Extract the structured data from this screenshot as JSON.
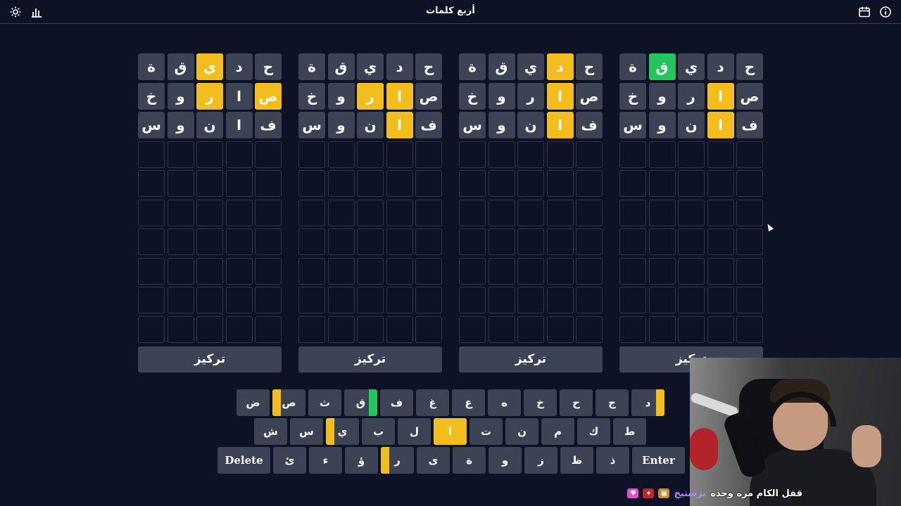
{
  "header": {
    "title": "أربع كلمات",
    "icons": [
      "settings-icon",
      "stats-icon",
      "calendar-icon",
      "info-icon"
    ]
  },
  "colors": {
    "background": "#0d1224",
    "filled_tile": "#3b4354",
    "present_yellow": "#f2bd1d",
    "correct_green": "#22c55e"
  },
  "boards": [
    {
      "focus_label": "تركيز",
      "rows": [
        [
          {
            "l": "ة",
            "s": "f"
          },
          {
            "l": "ق",
            "s": "f"
          },
          {
            "l": "ي",
            "s": "y"
          },
          {
            "l": "د",
            "s": "f"
          },
          {
            "l": "ح",
            "s": "f"
          }
        ],
        [
          {
            "l": "خ",
            "s": "f"
          },
          {
            "l": "و",
            "s": "f"
          },
          {
            "l": "ر",
            "s": "y"
          },
          {
            "l": "ا",
            "s": "f"
          },
          {
            "l": "ص",
            "s": "y"
          }
        ],
        [
          {
            "l": "س",
            "s": "f"
          },
          {
            "l": "و",
            "s": "f"
          },
          {
            "l": "ن",
            "s": "f"
          },
          {
            "l": "ا",
            "s": "f"
          },
          {
            "l": "ف",
            "s": "f"
          }
        ]
      ]
    },
    {
      "focus_label": "تركيز",
      "rows": [
        [
          {
            "l": "ة",
            "s": "f"
          },
          {
            "l": "ق",
            "s": "f"
          },
          {
            "l": "ي",
            "s": "f"
          },
          {
            "l": "د",
            "s": "f"
          },
          {
            "l": "ح",
            "s": "f"
          }
        ],
        [
          {
            "l": "خ",
            "s": "f"
          },
          {
            "l": "و",
            "s": "f"
          },
          {
            "l": "ر",
            "s": "y"
          },
          {
            "l": "ا",
            "s": "y"
          },
          {
            "l": "ص",
            "s": "f"
          }
        ],
        [
          {
            "l": "س",
            "s": "f"
          },
          {
            "l": "و",
            "s": "f"
          },
          {
            "l": "ن",
            "s": "f"
          },
          {
            "l": "ا",
            "s": "y"
          },
          {
            "l": "ف",
            "s": "f"
          }
        ]
      ]
    },
    {
      "focus_label": "تركيز",
      "rows": [
        [
          {
            "l": "ة",
            "s": "f"
          },
          {
            "l": "ق",
            "s": "f"
          },
          {
            "l": "ي",
            "s": "f"
          },
          {
            "l": "د",
            "s": "y"
          },
          {
            "l": "ح",
            "s": "f"
          }
        ],
        [
          {
            "l": "خ",
            "s": "f"
          },
          {
            "l": "و",
            "s": "f"
          },
          {
            "l": "ر",
            "s": "f"
          },
          {
            "l": "ا",
            "s": "y"
          },
          {
            "l": "ص",
            "s": "f"
          }
        ],
        [
          {
            "l": "س",
            "s": "f"
          },
          {
            "l": "و",
            "s": "f"
          },
          {
            "l": "ن",
            "s": "f"
          },
          {
            "l": "ا",
            "s": "y"
          },
          {
            "l": "ف",
            "s": "f"
          }
        ]
      ]
    },
    {
      "focus_label": "تركيز",
      "rows": [
        [
          {
            "l": "ة",
            "s": "f"
          },
          {
            "l": "ق",
            "s": "g"
          },
          {
            "l": "ي",
            "s": "f"
          },
          {
            "l": "د",
            "s": "f"
          },
          {
            "l": "ح",
            "s": "f"
          }
        ],
        [
          {
            "l": "خ",
            "s": "f"
          },
          {
            "l": "و",
            "s": "f"
          },
          {
            "l": "ر",
            "s": "f"
          },
          {
            "l": "ا",
            "s": "y"
          },
          {
            "l": "ص",
            "s": "f"
          }
        ],
        [
          {
            "l": "س",
            "s": "f"
          },
          {
            "l": "و",
            "s": "f"
          },
          {
            "l": "ن",
            "s": "f"
          },
          {
            "l": "ا",
            "s": "y"
          },
          {
            "l": "ف",
            "s": "f"
          }
        ]
      ]
    }
  ],
  "keyboard": {
    "rows": [
      [
        {
          "k": "ض"
        },
        {
          "k": "ص",
          "mark": "y-left"
        },
        {
          "k": "ث"
        },
        {
          "k": "ق",
          "mark": "g-right"
        },
        {
          "k": "ف"
        },
        {
          "k": "غ"
        },
        {
          "k": "ع"
        },
        {
          "k": "ه"
        },
        {
          "k": "خ"
        },
        {
          "k": "ح"
        },
        {
          "k": "ج"
        },
        {
          "k": "د",
          "mark": "y-right"
        }
      ],
      [
        {
          "k": "ش"
        },
        {
          "k": "س"
        },
        {
          "k": "ي",
          "mark": "y-left"
        },
        {
          "k": "ب"
        },
        {
          "k": "ل"
        },
        {
          "k": "ا",
          "mark": "full-y"
        },
        {
          "k": "ت"
        },
        {
          "k": "ن"
        },
        {
          "k": "م"
        },
        {
          "k": "ك"
        },
        {
          "k": "ط"
        }
      ],
      [
        {
          "k": "Delete",
          "wide": true
        },
        {
          "k": "ئ"
        },
        {
          "k": "ء"
        },
        {
          "k": "ؤ"
        },
        {
          "k": "ر",
          "mark": "y-left"
        },
        {
          "k": "ى"
        },
        {
          "k": "ة"
        },
        {
          "k": "و"
        },
        {
          "k": "ز"
        },
        {
          "k": "ظ"
        },
        {
          "k": "ذ"
        },
        {
          "k": "Enter",
          "wide": true
        }
      ]
    ]
  },
  "chat": {
    "username": "برستيج",
    "message": "قفل الكام مره وحده"
  }
}
